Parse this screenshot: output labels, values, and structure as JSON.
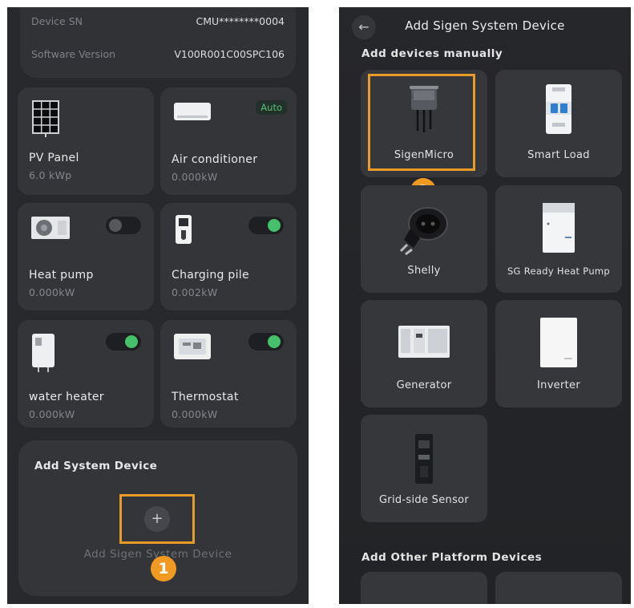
{
  "left_panel": {
    "info": {
      "device_sn_label": "Device SN",
      "device_sn_value": "CMU********0004",
      "software_version_label": "Software Version",
      "software_version_value": "V100R001C00SPC106"
    },
    "devices": [
      {
        "name": "PV Panel",
        "value": "6.0 kWp",
        "icon": "pv-panel-icon",
        "control": "none"
      },
      {
        "name": "Air conditioner",
        "value": "0.000kW",
        "icon": "air-conditioner-icon",
        "control": "badge",
        "badge": "Auto"
      },
      {
        "name": "Heat pump",
        "value": "0.000kW",
        "icon": "heat-pump-icon",
        "control": "toggle",
        "toggle_on": false
      },
      {
        "name": "Charging pile",
        "value": "0.002kW",
        "icon": "charging-pile-icon",
        "control": "toggle",
        "toggle_on": true
      },
      {
        "name": "water heater",
        "value": "0.000kW",
        "icon": "water-heater-icon",
        "control": "toggle",
        "toggle_on": true
      },
      {
        "name": "Thermostat",
        "value": "0.000kW",
        "icon": "thermostat-icon",
        "control": "toggle",
        "toggle_on": true
      }
    ],
    "add_section": {
      "title": "Add System Device",
      "button_icon": "+",
      "button_label": "Add Sigen System Device",
      "step": "1"
    }
  },
  "right_panel": {
    "back_icon": "←",
    "title": "Add Sigen System Device",
    "manual_heading": "Add devices manually",
    "tiles": [
      {
        "label": "SigenMicro",
        "icon": "sigenmicro-icon",
        "selected": true
      },
      {
        "label": "Smart Load",
        "icon": "smart-load-icon"
      },
      {
        "label": "Shelly",
        "icon": "shelly-plug-icon"
      },
      {
        "label": "SG Ready Heat Pump",
        "icon": "sg-ready-heat-pump-icon"
      },
      {
        "label": "Generator",
        "icon": "generator-icon"
      },
      {
        "label": "Inverter",
        "icon": "inverter-icon"
      },
      {
        "label": "Grid-side Sensor",
        "icon": "grid-side-sensor-icon"
      }
    ],
    "step": "2",
    "other_heading": "Add Other Platform Devices"
  },
  "colors": {
    "background": "#28292c",
    "card": "#333539",
    "highlight": "#e89b26",
    "toggle_on": "#46c06a",
    "step_badge": "#f09a22"
  }
}
